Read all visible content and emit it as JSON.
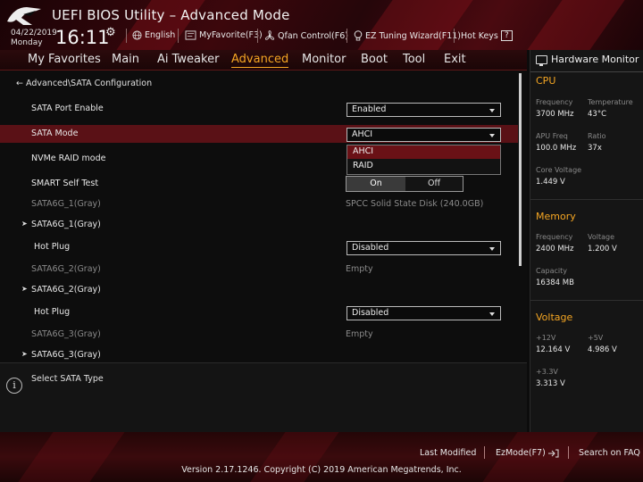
{
  "header": {
    "title": "UEFI BIOS Utility – Advanced Mode",
    "date": "04/22/2019",
    "day": "Monday",
    "time": "16:11",
    "items": [
      {
        "icon": "globe-icon",
        "label": "English"
      },
      {
        "icon": "favorite-icon",
        "label": "MyFavorite(F3)"
      },
      {
        "icon": "fan-icon",
        "label": "Qfan Control(F6)"
      },
      {
        "icon": "lightbulb-icon",
        "label": "EZ Tuning Wizard(F11)"
      },
      {
        "icon": "help-box-icon",
        "label": "Hot Keys",
        "box": "?"
      }
    ]
  },
  "menu": [
    "My Favorites",
    "Main",
    "Ai Tweaker",
    "Advanced",
    "Monitor",
    "Boot",
    "Tool",
    "Exit"
  ],
  "active_menu": "Advanced",
  "breadcrumb": "Advanced\\SATA Configuration",
  "settings": {
    "sata_port_enable": {
      "label": "SATA Port Enable",
      "value": "Enabled"
    },
    "sata_mode": {
      "label": "SATA Mode",
      "value": "AHCI",
      "options": [
        "AHCI",
        "RAID"
      ],
      "highlighted_option": "AHCI"
    },
    "nvme_raid": {
      "label": "NVMe RAID mode"
    },
    "smart": {
      "label": "SMART Self Test",
      "on": "On",
      "off": "Off",
      "selected": "On"
    },
    "port1_info": {
      "label": "SATA6G_1(Gray)",
      "value": "SPCC Solid State Disk (240.0GB)"
    },
    "port1_sub": {
      "label": "SATA6G_1(Gray)"
    },
    "hotplug1": {
      "label": "Hot Plug",
      "value": "Disabled"
    },
    "port2_info": {
      "label": "SATA6G_2(Gray)",
      "value": "Empty"
    },
    "port2_sub": {
      "label": "SATA6G_2(Gray)"
    },
    "hotplug2": {
      "label": "Hot Plug",
      "value": "Disabled"
    },
    "port3_info": {
      "label": "SATA6G_3(Gray)",
      "value": "Empty"
    },
    "port3_sub": {
      "label": "SATA6G_3(Gray)"
    }
  },
  "help_text": "Select SATA Type",
  "hw_monitor": {
    "title": "Hardware Monitor",
    "cpu": {
      "title": "CPU",
      "frequency_label": "Frequency",
      "frequency": "3700 MHz",
      "temperature_label": "Temperature",
      "temperature": "43°C",
      "apu_label": "APU Freq",
      "apu": "100.0 MHz",
      "ratio_label": "Ratio",
      "ratio": "37x",
      "core_voltage_label": "Core Voltage",
      "core_voltage": "1.449 V"
    },
    "memory": {
      "title": "Memory",
      "frequency_label": "Frequency",
      "frequency": "2400 MHz",
      "voltage_label": "Voltage",
      "voltage": "1.200 V",
      "capacity_label": "Capacity",
      "capacity": "16384 MB"
    },
    "voltage": {
      "title": "Voltage",
      "v12_label": "+12V",
      "v12": "12.164 V",
      "v5_label": "+5V",
      "v5": "4.986 V",
      "v33_label": "+3.3V",
      "v33": "3.313 V"
    }
  },
  "footer": {
    "last_modified": "Last Modified",
    "ezmode": "EzMode(F7)",
    "search": "Search on FAQ",
    "copyright": "Version 2.17.1246. Copyright (C) 2019 American Megatrends, Inc."
  },
  "colors": {
    "accent": "#f5a623",
    "selection": "#5a1116",
    "header_red": "#3c070c"
  }
}
